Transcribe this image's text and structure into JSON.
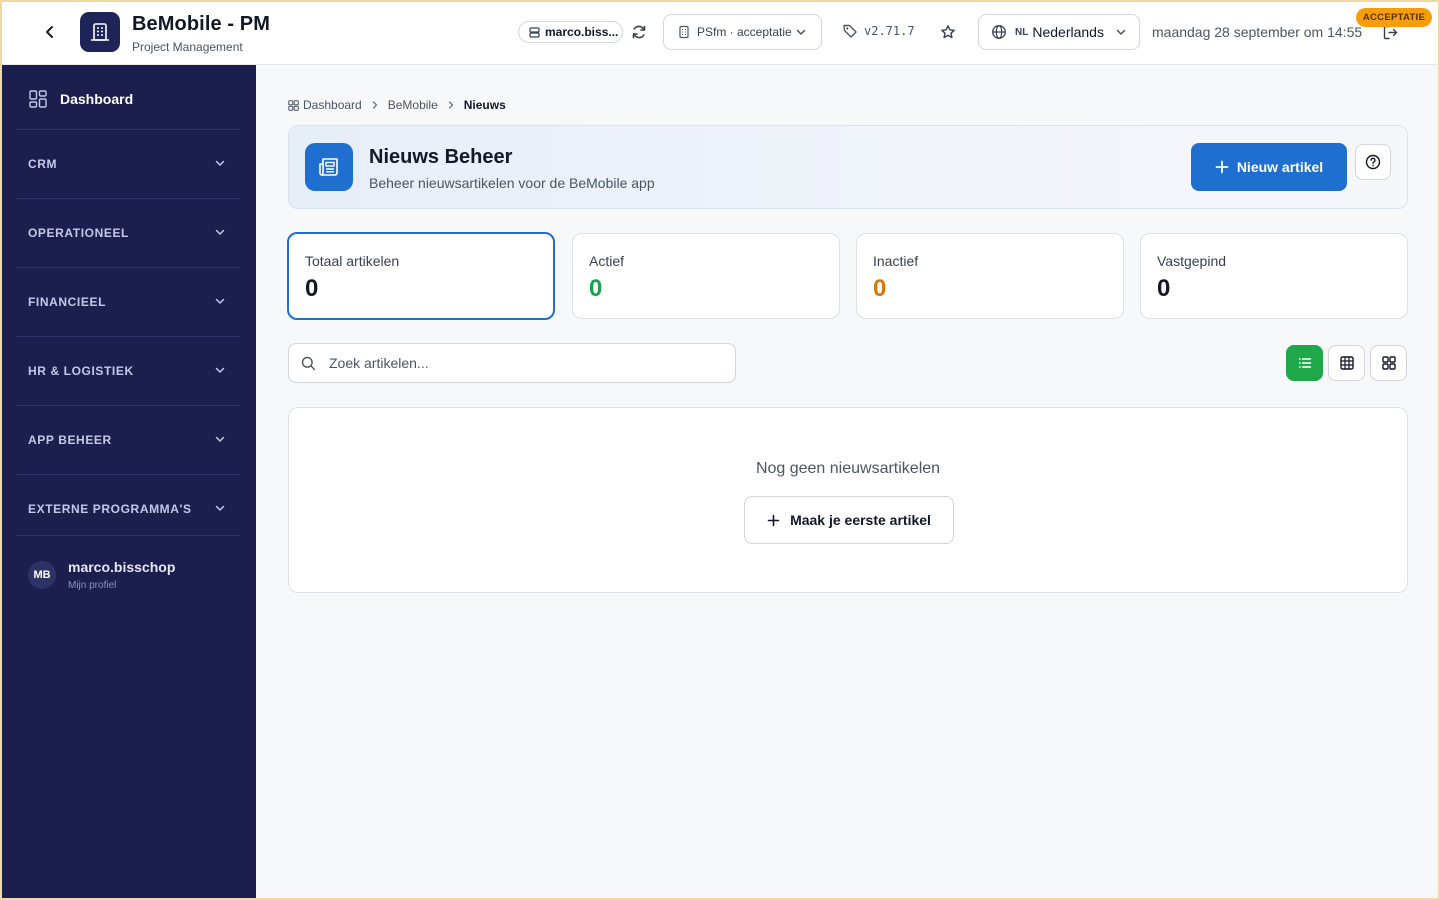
{
  "header": {
    "app_title": "BeMobile - PM",
    "app_subtitle": "Project Management",
    "user_chip": "marco.biss...",
    "environment": "PSfm · acceptatie",
    "version": "v2.71.7",
    "language_code": "NL",
    "language": "Nederlands",
    "datetime": "maandag 28 september om 14:55",
    "env_badge": "ACCEPTATIE"
  },
  "sidebar": {
    "dashboard_label": "Dashboard",
    "groups": [
      {
        "label": "CRM"
      },
      {
        "label": "OPERATIONEEL"
      },
      {
        "label": "FINANCIEEL"
      },
      {
        "label": "HR & LOGISTIEK"
      },
      {
        "label": "APP BEHEER"
      },
      {
        "label": "EXTERNE PROGRAMMA'S"
      }
    ],
    "user": {
      "initials": "MB",
      "name": "marco.bisschop",
      "subtitle": "Mijn profiel"
    }
  },
  "breadcrumb": {
    "items": [
      "Dashboard",
      "BeMobile",
      "Nieuws"
    ]
  },
  "page": {
    "title": "Nieuws Beheer",
    "subtitle": "Beheer nieuwsartikelen voor de BeMobile app",
    "new_button": "Nieuw artikel"
  },
  "stats": [
    {
      "label": "Totaal artikelen",
      "value": "0",
      "color": "#111827"
    },
    {
      "label": "Actief",
      "value": "0",
      "color": "#16a34a"
    },
    {
      "label": "Inactief",
      "value": "0",
      "color": "#d97706"
    },
    {
      "label": "Vastgepind",
      "value": "0",
      "color": "#111827"
    }
  ],
  "search": {
    "placeholder": "Zoek artikelen...",
    "value": ""
  },
  "view_modes": [
    "list-icon",
    "table-icon",
    "grid-icon"
  ],
  "empty_state": {
    "message": "Nog geen nieuwsartikelen",
    "button": "Maak je eerste artikel"
  },
  "colors": {
    "sidebar": "#1c1f4e",
    "primary": "#1f6fd1",
    "view_selected": "#1ea84a",
    "badge": "#f59e0b"
  }
}
